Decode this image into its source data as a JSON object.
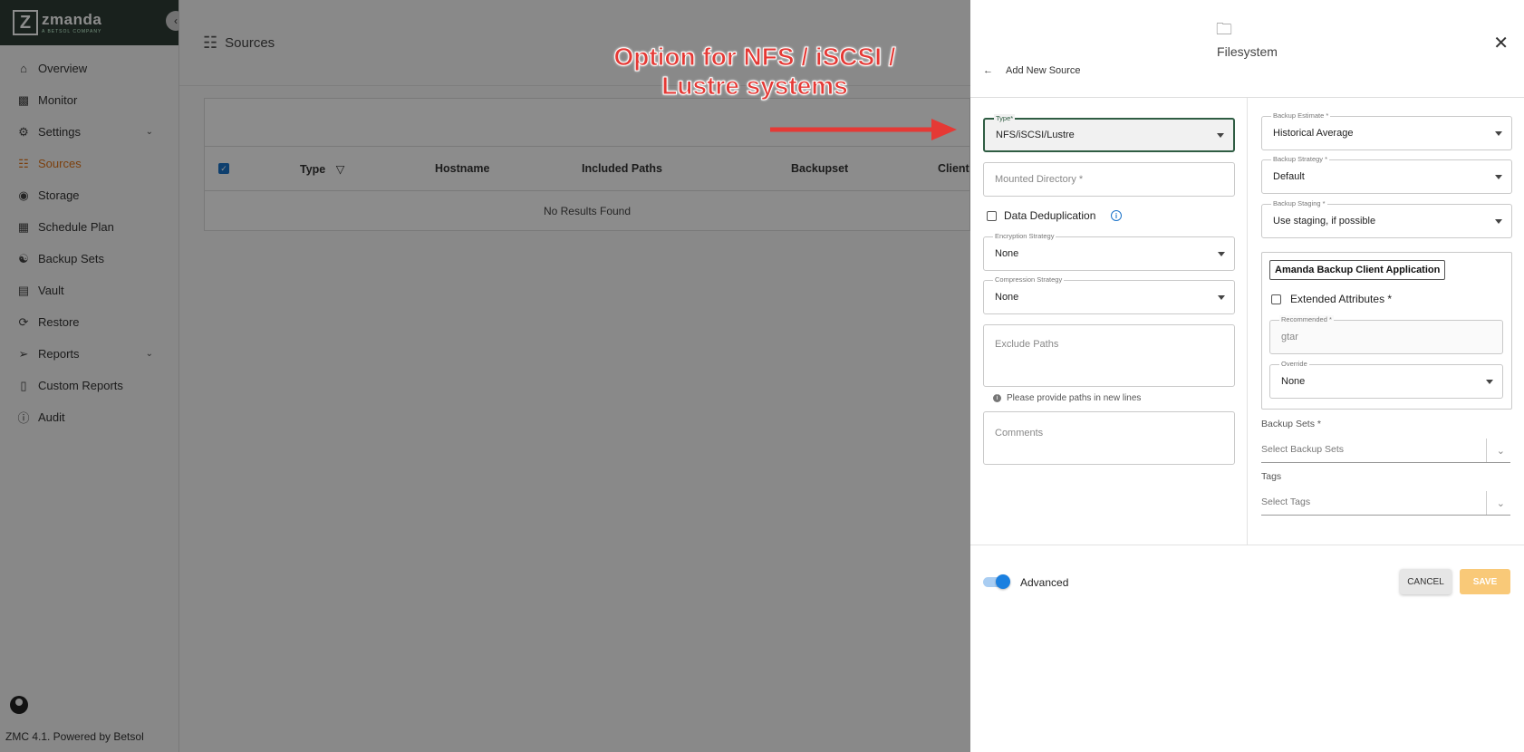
{
  "app": {
    "brand_name": "zmanda",
    "brand_sub": "A BETSOL COMPANY",
    "footer": "ZMC 4.1. Powered by Betsol"
  },
  "sidebar": {
    "items": [
      {
        "label": "Overview",
        "icon": "home-icon"
      },
      {
        "label": "Monitor",
        "icon": "monitor-icon"
      },
      {
        "label": "Settings",
        "icon": "gear-icon",
        "expandable": true
      },
      {
        "label": "Sources",
        "icon": "network-icon",
        "active": true
      },
      {
        "label": "Storage",
        "icon": "storage-icon"
      },
      {
        "label": "Schedule Plan",
        "icon": "calendar-icon"
      },
      {
        "label": "Backup Sets",
        "icon": "backup-sets-icon"
      },
      {
        "label": "Vault",
        "icon": "vault-icon"
      },
      {
        "label": "Restore",
        "icon": "restore-icon"
      },
      {
        "label": "Reports",
        "icon": "reports-icon",
        "expandable": true
      },
      {
        "label": "Custom Reports",
        "icon": "custom-report-icon"
      },
      {
        "label": "Audit",
        "icon": "info-icon"
      }
    ],
    "active_color": "#e2761b"
  },
  "main": {
    "page_title": "Sources",
    "columns": [
      "Type",
      "Hostname",
      "Included Paths",
      "Backupset",
      "Client"
    ],
    "empty_text": "No Results Found"
  },
  "annotation": {
    "line1": "Option for NFS / iSCSI /",
    "line2": "Lustre systems",
    "color": "#e53935"
  },
  "drawer": {
    "title": "Filesystem",
    "back_label": "Add New Source",
    "left": {
      "type_label": "Type*",
      "type_value": "NFS/iSCSI/Lustre",
      "mounted_dir_placeholder": "Mounted Directory *",
      "dedup_label": "Data Deduplication",
      "encryption_label": "Encryption Strategy",
      "encryption_value": "None",
      "compression_label": "Compression Strategy",
      "compression_value": "None",
      "exclude_placeholder": "Exclude Paths",
      "exclude_hint": "Please provide paths in new lines",
      "comments_placeholder": "Comments"
    },
    "right": {
      "estimate_label": "Backup Estimate *",
      "estimate_value": "Historical Average",
      "strategy_label": "Backup Strategy *",
      "strategy_value": "Default",
      "staging_label": "Backup Staging *",
      "staging_value": "Use staging, if possible",
      "client_app_label": "Amanda Backup Client Application",
      "ext_attr_label": "Extended Attributes *",
      "recommended_label": "Recommended *",
      "recommended_value": "gtar",
      "override_label": "Override",
      "override_value": "None",
      "backup_sets_label": "Backup Sets *",
      "backup_sets_placeholder": "Select Backup Sets",
      "tags_label": "Tags",
      "tags_placeholder": "Select Tags"
    },
    "advanced_label": "Advanced",
    "advanced_on": true,
    "cancel_label": "CANCEL",
    "save_label": "SAVE",
    "save_color": "#f9c978"
  }
}
